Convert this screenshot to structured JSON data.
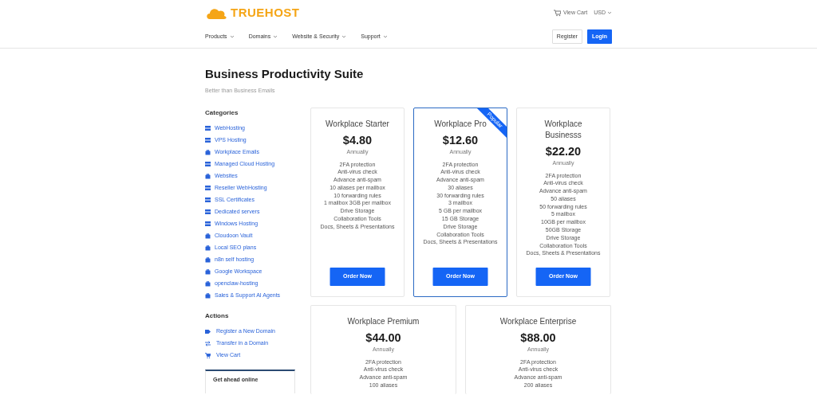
{
  "header": {
    "logo": "TRUEHOST",
    "cart_link": "View Cart",
    "currency": "USD"
  },
  "nav": {
    "items": [
      "Products",
      "Domains",
      "Website & Security",
      "Support"
    ],
    "register": "Register",
    "login": "Login"
  },
  "page": {
    "title": "Business Productivity Suite",
    "subtitle": "Better than Business Emails"
  },
  "categories": {
    "heading": "Categories",
    "items": [
      {
        "label": "WebHosting",
        "kind": "server"
      },
      {
        "label": "VPS Hosting",
        "kind": "server"
      },
      {
        "label": "Workplace Emails",
        "kind": "case"
      },
      {
        "label": "Managed Cloud Hosting",
        "kind": "server"
      },
      {
        "label": "Websites",
        "kind": "case"
      },
      {
        "label": "Reseller WebHosting",
        "kind": "server"
      },
      {
        "label": "SSL Certificates",
        "kind": "server"
      },
      {
        "label": "Dedicated servers",
        "kind": "server"
      },
      {
        "label": "Windows Hosting",
        "kind": "server"
      },
      {
        "label": "Cloudoon Vault",
        "kind": "case"
      },
      {
        "label": "Local SEO plans",
        "kind": "case"
      },
      {
        "label": "n8n self hosting",
        "kind": "case"
      },
      {
        "label": "Google Workspace",
        "kind": "case"
      },
      {
        "label": "openclaw-hosting",
        "kind": "case"
      },
      {
        "label": "Sales & Support AI Agents",
        "kind": "case"
      }
    ]
  },
  "actions": {
    "heading": "Actions",
    "items": [
      {
        "label": "Register a New Domain",
        "kind": "tag"
      },
      {
        "label": "Transfer in a Domain",
        "kind": "transfer"
      },
      {
        "label": "View Cart",
        "kind": "cart"
      }
    ]
  },
  "promo": {
    "title": "Get ahead online"
  },
  "plans": [
    {
      "name": "Workplace Starter",
      "price": "$4.80",
      "period": "Annually",
      "featured": false,
      "features": [
        "2FA protection",
        "Anti-virus check",
        "Advance anti-spam",
        "10 aliases per mailbox",
        "10 forwarding rules",
        "1 mailbox 3GB per mailbox",
        "Drive Storage",
        "Collaboration Tools",
        "Docs, Sheets & Presentations"
      ],
      "button": "Order Now"
    },
    {
      "name": "Workplace Pro",
      "price": "$12.60",
      "period": "Annually",
      "featured": true,
      "ribbon": "Popular",
      "features": [
        "2FA protection",
        "Anti-virus check",
        "Advance anti-spam",
        "30 aliases",
        "30 forwarding rules",
        "3 mailbox",
        "5 GB per mailbox",
        "15 GB Storage",
        "Drive Storage",
        "Collaboration Tools",
        "Docs, Sheets & Presentations"
      ],
      "button": "Order Now"
    },
    {
      "name": "Workplace Businesss",
      "price": "$22.20",
      "period": "Annually",
      "featured": false,
      "features": [
        "2FA protection",
        "Anti-virus check",
        "Advance anti-spam",
        "50 aliases",
        "50 forwarding rules",
        "5 mailbox",
        "10GB per mailbox",
        "50GB Storage",
        "Drive Storage",
        "Collaboration Tools",
        "Docs, Sheets & Presentations"
      ],
      "button": "Order Now"
    },
    {
      "name": "Workplace Premium",
      "price": "$44.00",
      "period": "Annually",
      "featured": false,
      "features": [
        "2FA protection",
        "Anti-virus check",
        "Advance anti-spam",
        "100 aliases"
      ]
    },
    {
      "name": "Workplace Enterprise",
      "price": "$88.00",
      "period": "Annually",
      "featured": false,
      "features": [
        "2FA protection",
        "Anti-virus check",
        "Advance anti-spam",
        "200 aliases"
      ]
    }
  ]
}
